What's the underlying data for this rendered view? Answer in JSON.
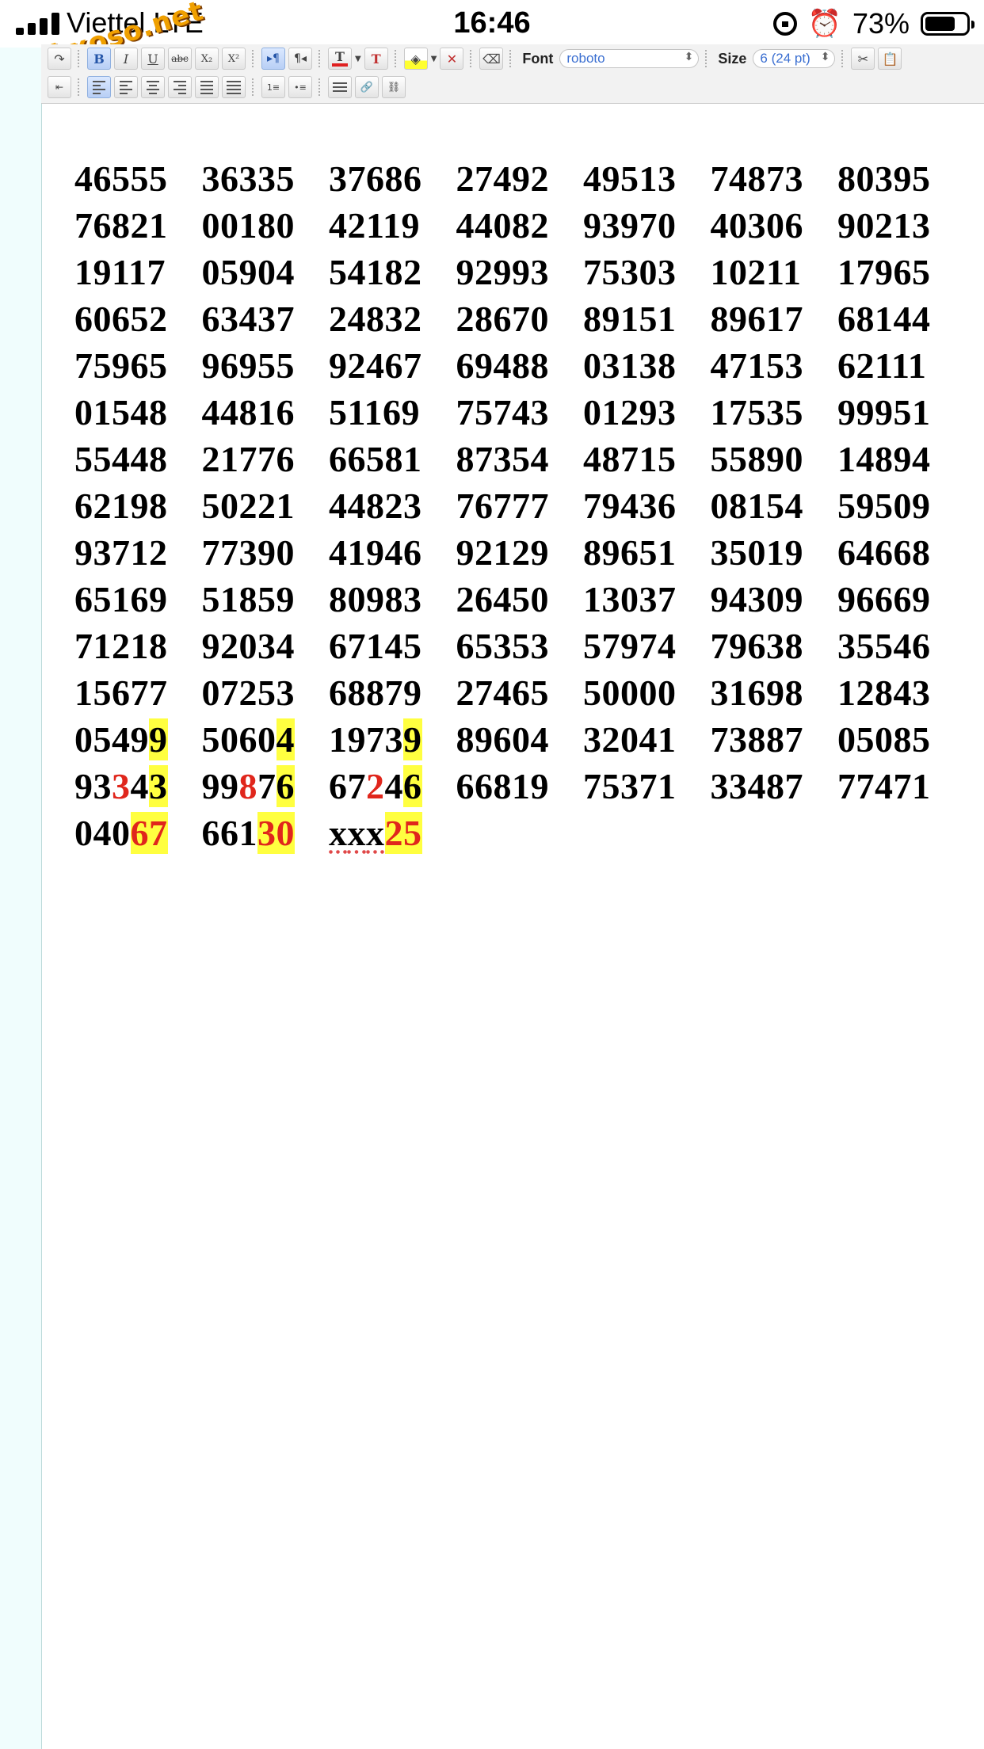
{
  "status_bar": {
    "carrier": "Viettel LTE",
    "time": "16:46",
    "battery": "73%",
    "battery_level": 0.73
  },
  "watermark": "webxoso.net",
  "toolbar": {
    "font_label": "Font",
    "font_value": "roboto",
    "size_label": "Size",
    "size_value": "6 (24 pt)",
    "bold": "B",
    "italic": "I",
    "underline": "U",
    "strike": "abc",
    "subscript": "X₂",
    "superscript": "X²",
    "text_color": "T"
  },
  "document": {
    "rows": [
      [
        "46555",
        "36335",
        "37686",
        "27492",
        "49513",
        "74873",
        "80395"
      ],
      [
        "76821",
        "00180",
        "42119",
        "44082",
        "93970",
        "40306",
        "90213"
      ],
      [
        "19117",
        "05904",
        "54182",
        "92993",
        "75303",
        "10211",
        "17965"
      ],
      [
        "60652",
        "63437",
        "24832",
        "28670",
        "89151",
        "89617",
        "68144"
      ],
      [
        "75965",
        "96955",
        "92467",
        "69488",
        "03138",
        "47153",
        "62111"
      ],
      [
        "01548",
        "44816",
        "51169",
        "75743",
        "01293",
        "17535",
        "99951"
      ],
      [
        "55448",
        "21776",
        "66581",
        "87354",
        "48715",
        "55890",
        "14894"
      ],
      [
        "62198",
        "50221",
        "44823",
        "76777",
        "79436",
        "08154",
        "59509"
      ],
      [
        "93712",
        "77390",
        "41946",
        "92129",
        "89651",
        "35019",
        "64668"
      ],
      [
        "65169",
        "51859",
        "80983",
        "26450",
        "13037",
        "94309",
        "96669"
      ],
      [
        "71218",
        "92034",
        "67145",
        "65353",
        "57974",
        "79638",
        "35546"
      ],
      [
        "15677",
        "07253",
        "68879",
        "27465",
        "50000",
        "31698",
        "12843"
      ],
      [
        "05499",
        "50604",
        "19739",
        "89604",
        "32041",
        "73887",
        "05085"
      ],
      [
        "93343",
        "99876",
        "67246",
        "66819",
        "75371",
        "33487",
        "77471"
      ],
      [
        "04067",
        "66130",
        "xxx25"
      ]
    ],
    "marks": {
      "12": {
        "0": {
          "hl": [
            4
          ]
        },
        "1": {
          "hl": [
            4
          ]
        },
        "2": {
          "hl": [
            4
          ]
        }
      },
      "13": {
        "0": {
          "red": [
            2
          ],
          "hl": [
            4
          ]
        },
        "1": {
          "red": [
            2
          ],
          "hl": [
            4
          ]
        },
        "2": {
          "red": [
            2
          ],
          "hl": [
            4
          ]
        }
      },
      "14": {
        "0": {
          "red": [
            3,
            4
          ],
          "hl": [
            3,
            4
          ]
        },
        "1": {
          "red": [
            3,
            4
          ],
          "hl": [
            3,
            4
          ]
        },
        "2": {
          "red": [
            3,
            4
          ],
          "hl": [
            3,
            4
          ],
          "wavy": [
            0,
            1,
            2
          ]
        }
      }
    }
  }
}
